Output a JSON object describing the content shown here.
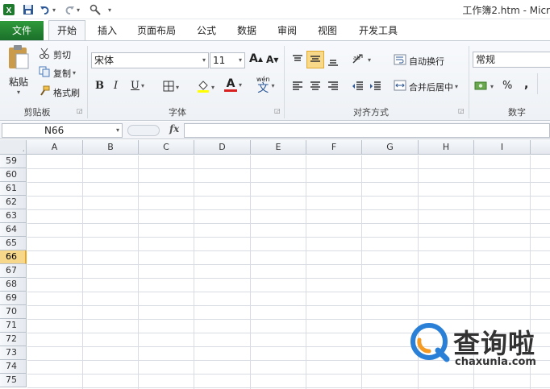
{
  "window": {
    "title": "工作簿2.htm - Micr"
  },
  "quick_access": {
    "save_icon": "save-icon",
    "undo_icon": "undo-icon",
    "redo_icon": "redo-icon",
    "customize_icon": "customize-icon"
  },
  "tabs": [
    {
      "label": "文件"
    },
    {
      "label": "开始"
    },
    {
      "label": "插入"
    },
    {
      "label": "页面布局"
    },
    {
      "label": "公式"
    },
    {
      "label": "数据"
    },
    {
      "label": "审阅"
    },
    {
      "label": "视图"
    },
    {
      "label": "开发工具"
    }
  ],
  "ribbon": {
    "clipboard": {
      "label": "剪贴板",
      "paste": "粘贴",
      "cut": "剪切",
      "copy": "复制",
      "format_painter": "格式刷"
    },
    "font": {
      "label": "字体",
      "font_name": "宋体",
      "font_size": "11",
      "bold": "B",
      "italic": "I",
      "underline": "U",
      "grow": "A",
      "shrink": "A",
      "font_color_letter": "A",
      "phonetic": "wén",
      "phonetic_char": "文"
    },
    "alignment": {
      "label": "对齐方式",
      "wrap_text": "自动换行",
      "merge_center": "合并后居中"
    },
    "number": {
      "label": "数字",
      "format": "常规",
      "percent": "%",
      "comma": ","
    }
  },
  "formula_bar": {
    "name_box": "N66",
    "fx": "fx",
    "value": ""
  },
  "sheet": {
    "columns": [
      "A",
      "B",
      "C",
      "D",
      "E",
      "F",
      "G",
      "H",
      "I"
    ],
    "rows": [
      "59",
      "60",
      "61",
      "62",
      "63",
      "64",
      "65",
      "66",
      "67",
      "68",
      "69",
      "70",
      "71",
      "72",
      "73",
      "74",
      "75"
    ],
    "selected_row": "66"
  },
  "watermark": {
    "name": "查询啦",
    "url": "chaxunla.com"
  },
  "colors": {
    "file_tab": "#1f7a2e",
    "selected_header": "#f7d88a",
    "grid_line": "#d9dde3",
    "watermark_blue": "#2a7fd6",
    "watermark_orange": "#f59a23"
  }
}
